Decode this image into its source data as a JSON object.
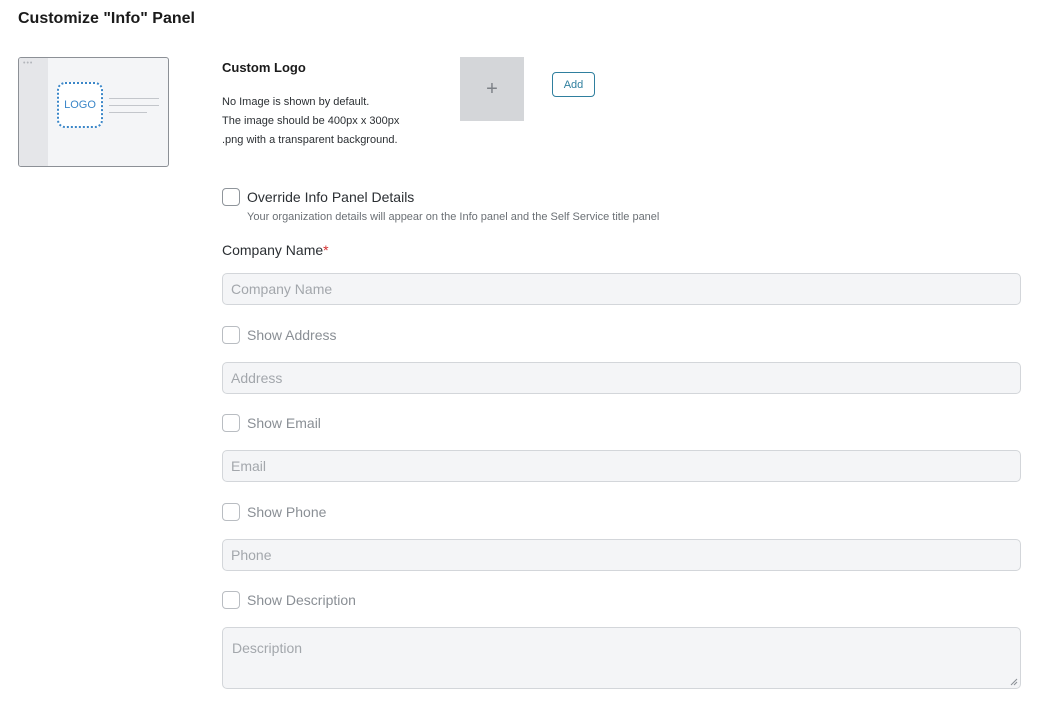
{
  "page": {
    "title": "Customize \"Info\" Panel"
  },
  "preview": {
    "logo_text": "LOGO"
  },
  "custom_logo": {
    "title": "Custom Logo",
    "description": [
      "No Image is shown by default.",
      "The image should be 400px x 300px",
      ".png with a transparent background."
    ],
    "upload_icon": "plus-icon",
    "add_label": "Add"
  },
  "override": {
    "label": "Override Info Panel Details",
    "hint": "Your organization details will appear on the Info panel and the Self Service title panel",
    "checked": false
  },
  "company_name": {
    "label": "Company Name",
    "required_mark": "*",
    "placeholder": "Company Name"
  },
  "address": {
    "toggle_label": "Show Address",
    "placeholder": "Address",
    "checked": false
  },
  "email": {
    "toggle_label": "Show Email",
    "placeholder": "Email",
    "checked": false
  },
  "phone": {
    "toggle_label": "Show Phone",
    "placeholder": "Phone",
    "checked": false
  },
  "description": {
    "toggle_label": "Show Description",
    "placeholder": "Description",
    "checked": false
  },
  "colors": {
    "accent": "#2f7f9e",
    "logo_blue": "#3a86c8",
    "required": "#d32f2f"
  }
}
